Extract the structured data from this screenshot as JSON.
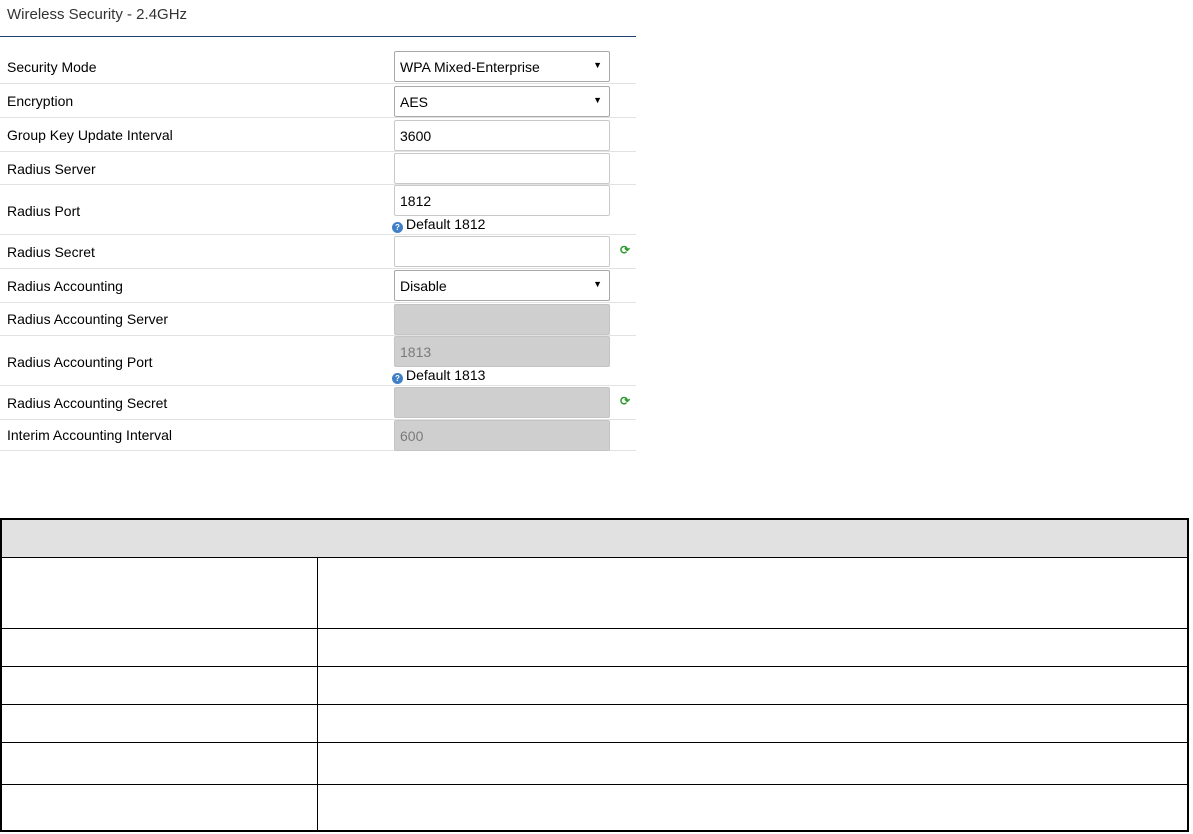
{
  "panel": {
    "title": "Wireless Security - 2.4GHz"
  },
  "fields": {
    "security_mode": {
      "label": "Security Mode",
      "value": "WPA Mixed-Enterprise",
      "arrow": "▼"
    },
    "encryption": {
      "label": "Encryption",
      "value": "AES",
      "arrow": "▼"
    },
    "group_key_interval": {
      "label": "Group Key Update Interval",
      "value": "3600"
    },
    "radius_server": {
      "label": "Radius Server",
      "value": ""
    },
    "radius_port": {
      "label": "Radius Port",
      "value": "1812",
      "hint": "Default 1812"
    },
    "radius_secret": {
      "label": "Radius Secret",
      "value": ""
    },
    "radius_accounting": {
      "label": "Radius Accounting",
      "value": "Disable",
      "arrow": "▼"
    },
    "radius_accounting_server": {
      "label": "Radius Accounting Server",
      "value": ""
    },
    "radius_accounting_port": {
      "label": "Radius Accounting Port",
      "value": "1813",
      "hint": "Default 1813"
    },
    "radius_accounting_secret": {
      "label": "Radius Accounting Secret",
      "value": ""
    },
    "interim_accounting_interval": {
      "label": "Interim Accounting Interval",
      "value": "600"
    }
  },
  "icons": {
    "help": "?",
    "refresh": "⟳"
  },
  "colors": {
    "title_rule": "#1f3f6f",
    "disabled_field": "#cfcfcf",
    "help_icon": "#3f7fc7",
    "refresh_icon": "#2f9a2f",
    "table_header": "#e1e1e1"
  }
}
